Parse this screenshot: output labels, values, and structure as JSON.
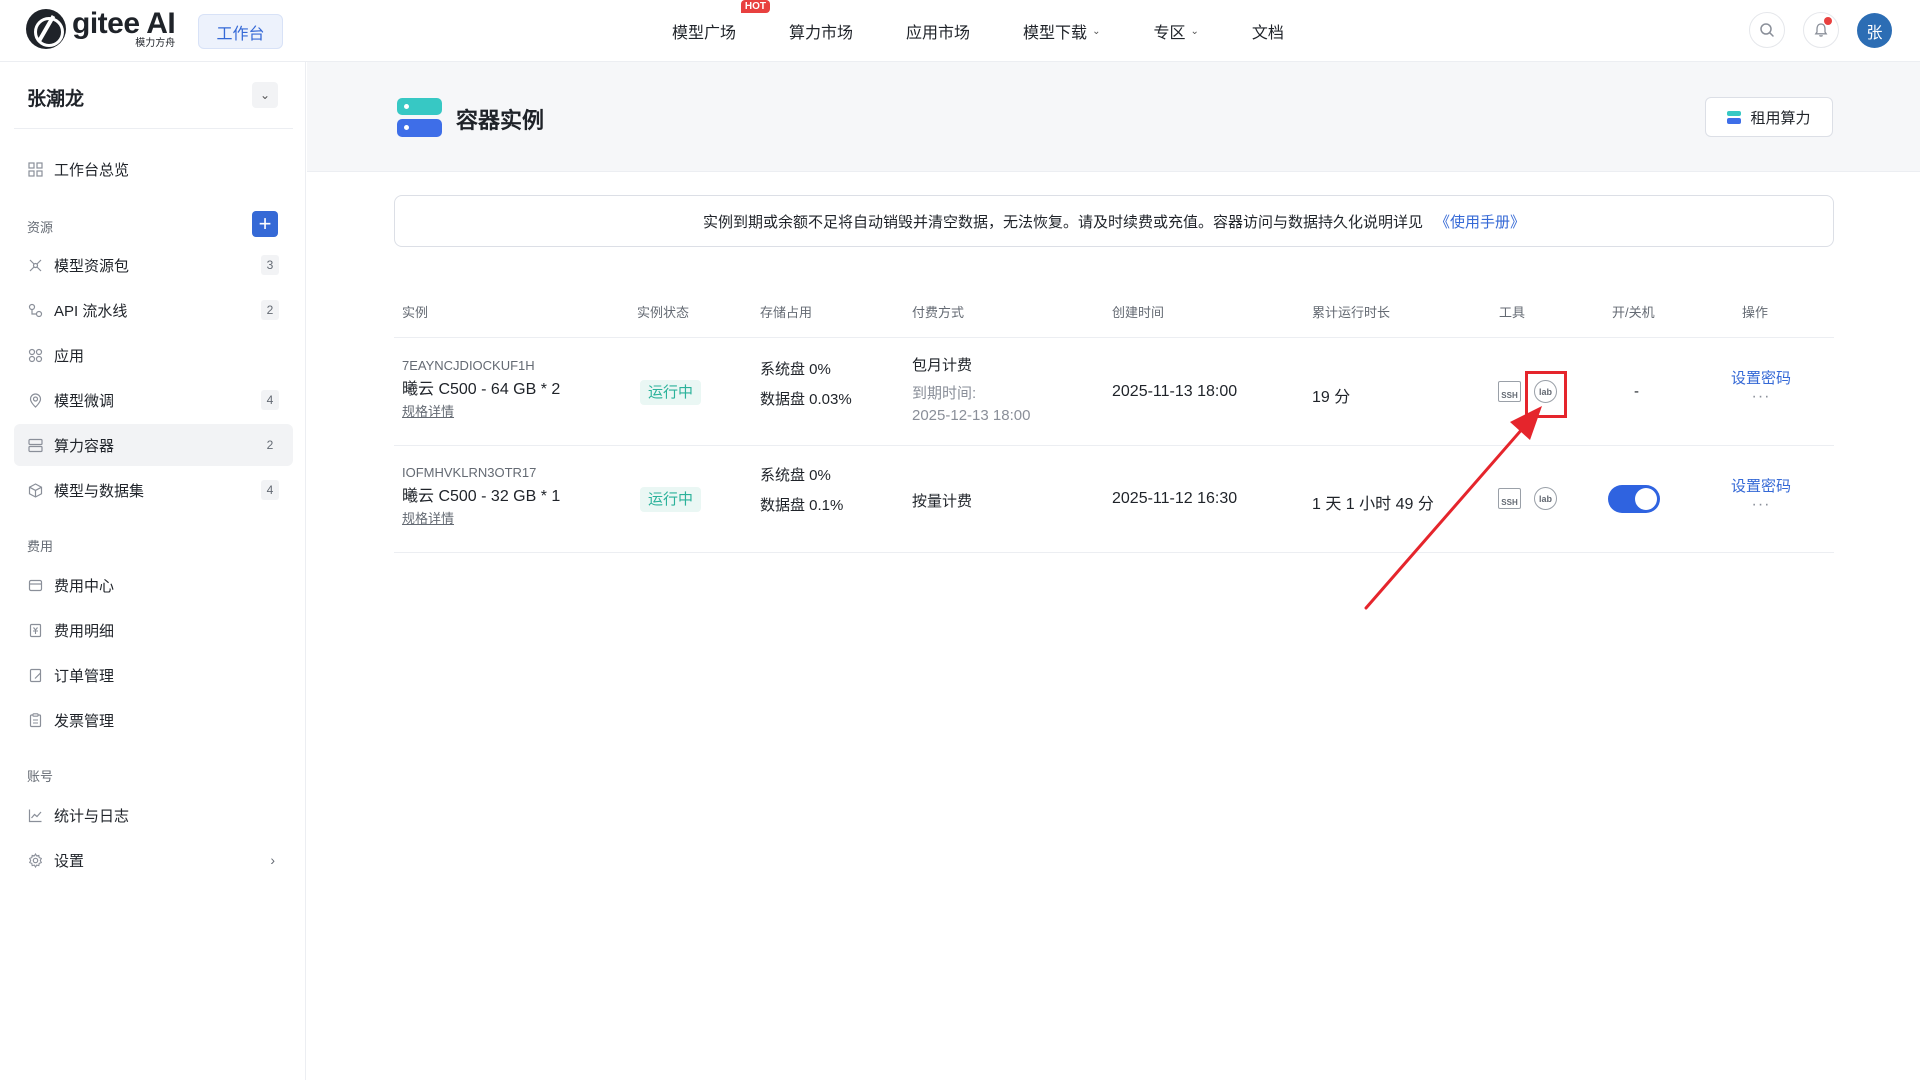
{
  "header": {
    "brand": "gitee AI",
    "brand_sub": "模力方舟",
    "workbench_label": "工作台",
    "nav": [
      {
        "label": "模型广场",
        "badge": "HOT"
      },
      {
        "label": "算力市场"
      },
      {
        "label": "应用市场"
      },
      {
        "label": "模型下载",
        "has_dropdown": true
      },
      {
        "label": "专区",
        "has_dropdown": true
      },
      {
        "label": "文档"
      }
    ],
    "icons": [
      "search-icon",
      "bell-icon"
    ],
    "avatar_text": "张"
  },
  "sidebar": {
    "username": "张潮龙",
    "overview_label": "工作台总览",
    "sections": {
      "resources": "资源",
      "billing": "费用",
      "account": "账号"
    },
    "resource_items": [
      {
        "label": "模型资源包",
        "count": "3",
        "icon": "model-package-icon"
      },
      {
        "label": "API 流水线",
        "count": "2",
        "icon": "pipeline-icon"
      },
      {
        "label": "应用",
        "count": "",
        "icon": "apps-icon"
      },
      {
        "label": "模型微调",
        "count": "4",
        "icon": "finetune-icon"
      },
      {
        "label": "算力容器",
        "count": "2",
        "icon": "container-icon",
        "active": true
      },
      {
        "label": "模型与数据集",
        "count": "4",
        "icon": "cube-icon"
      }
    ],
    "billing_items": [
      {
        "label": "费用中心",
        "icon": "wallet-icon"
      },
      {
        "label": "费用明细",
        "icon": "receipt-icon"
      },
      {
        "label": "订单管理",
        "icon": "order-icon"
      },
      {
        "label": "发票管理",
        "icon": "invoice-icon"
      }
    ],
    "account_items": [
      {
        "label": "统计与日志",
        "icon": "chart-icon"
      },
      {
        "label": "设置",
        "icon": "gear-icon",
        "has_submenu": true
      }
    ]
  },
  "page": {
    "title": "容器实例",
    "rent_button": "租用算力",
    "notice": "实例到期或余额不足将自动销毁并清空数据，无法恢复。请及时续费或充值。容器访问与数据持久化说明详见",
    "notice_link": "《使用手册》"
  },
  "table": {
    "headers": [
      "实例",
      "实例状态",
      "存储占用",
      "付费方式",
      "创建时间",
      "累计运行时长",
      "工具",
      "开/关机",
      "操作"
    ],
    "rows": [
      {
        "id": "7EAYNCJDIOCKUF1H",
        "name": "曦云 C500 - 64 GB * 2",
        "detail_link": "规格详情",
        "status": "运行中",
        "storage_system": "系统盘 0%",
        "storage_data": "数据盘 0.03%",
        "pay_method": "包月计费",
        "expire_label": "到期时间:",
        "expire_time": "2025-12-13 18:00",
        "created": "2025-11-13 18:00",
        "runtime": "19 分",
        "tools": [
          "SSH",
          "lab"
        ],
        "power": "-",
        "op_label": "设置密码",
        "op_more": "···"
      },
      {
        "id": "IOFMHVKLRN3OTR17",
        "name": "曦云 C500 - 32 GB * 1",
        "detail_link": "规格详情",
        "status": "运行中",
        "storage_system": "系统盘 0%",
        "storage_data": "数据盘 0.1%",
        "pay_method": "按量计费",
        "created": "2025-11-12 16:30",
        "runtime": "1 天 1 小时 49 分",
        "tools": [
          "SSH",
          "lab"
        ],
        "power": "on",
        "op_label": "设置密码",
        "op_more": "···"
      }
    ]
  },
  "colors": {
    "accent": "#3569d6",
    "status_green": "#2ab29a",
    "annotation_red": "#e5252c"
  }
}
